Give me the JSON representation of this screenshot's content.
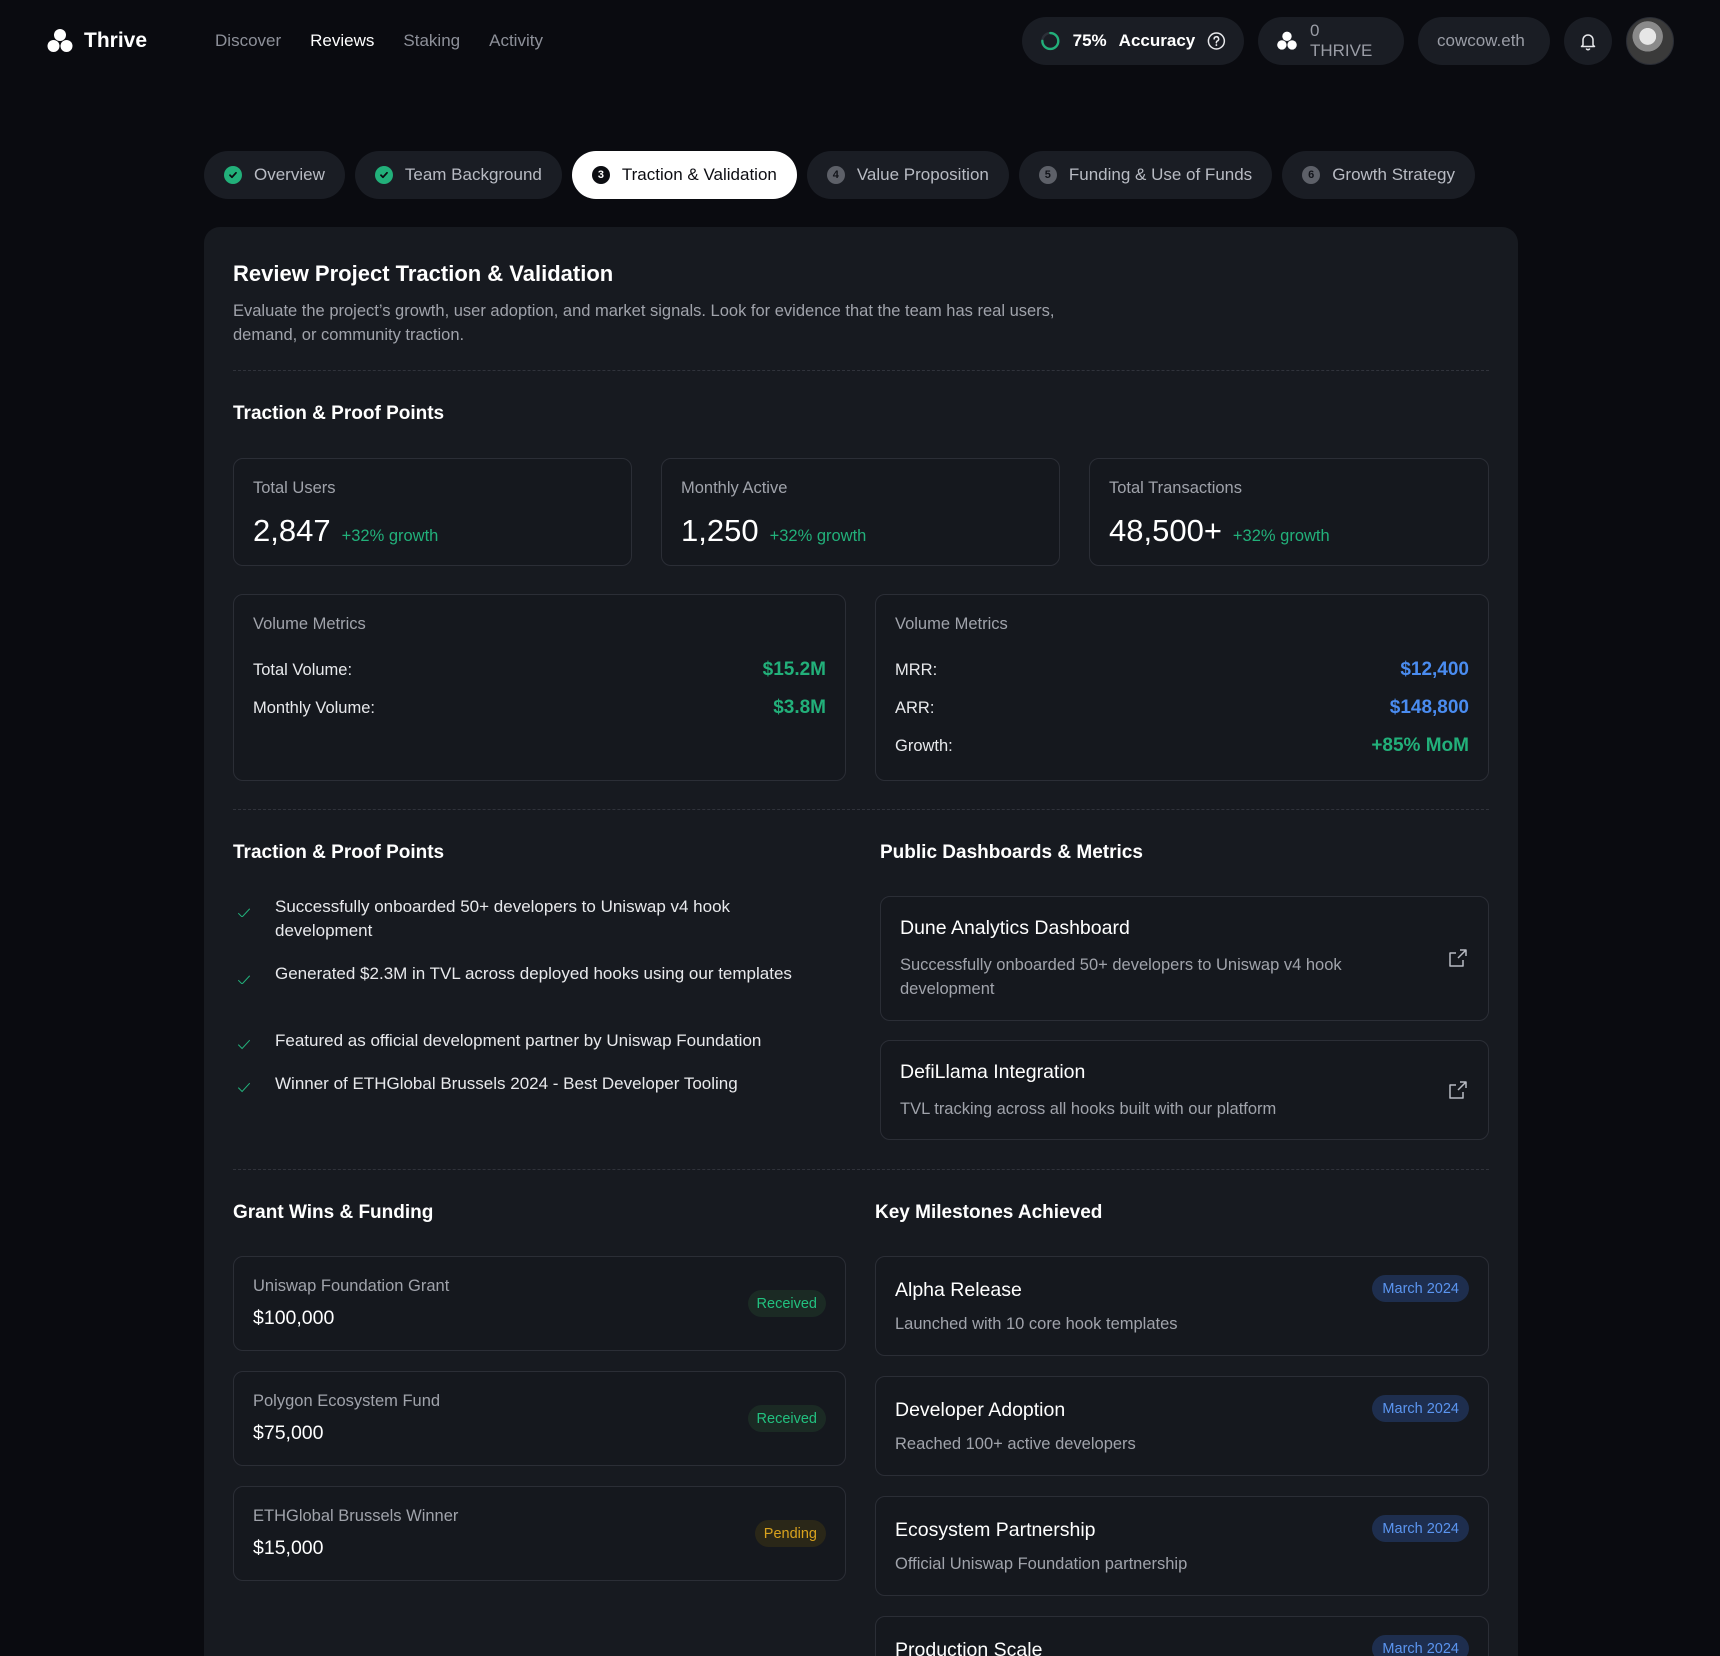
{
  "nav": {
    "brand": "Thrive",
    "links": [
      "Discover",
      "Reviews",
      "Staking",
      "Activity"
    ],
    "active_link": "Reviews",
    "accuracy_pct": "75%",
    "accuracy_label": "Accuracy",
    "thrive_balance": "0 THRIVE",
    "wallet": "cowcow.eth"
  },
  "steps": [
    {
      "label": "Overview",
      "status": "done"
    },
    {
      "label": "Team Background",
      "status": "done"
    },
    {
      "label": "Traction & Validation",
      "status": "active",
      "num": "3"
    },
    {
      "label": "Value Proposition",
      "status": "todo",
      "num": "4"
    },
    {
      "label": "Funding & Use of Funds",
      "status": "todo",
      "num": "5"
    },
    {
      "label": "Growth Strategy",
      "status": "todo",
      "num": "6"
    }
  ],
  "card": {
    "title": "Review Project Traction & Validation",
    "description": "Evaluate the project’s growth, user adoption, and market signals. Look for evidence that the team has real users, demand, or community traction."
  },
  "traction_section_title": "Traction & Proof Points",
  "stats": [
    {
      "label": "Total Users",
      "value": "2,847",
      "growth": "+32% growth"
    },
    {
      "label": "Monthly Active",
      "value": "1,250",
      "growth": "+32% growth"
    },
    {
      "label": "Total Transactions",
      "value": "48,500+",
      "growth": "+32% growth"
    }
  ],
  "volume_left": {
    "title": "Volume Metrics",
    "rows": [
      {
        "label": "Total Volume:",
        "value": "$15.2M"
      },
      {
        "label": "Monthly Volume:",
        "value": "$3.8M"
      }
    ]
  },
  "volume_right": {
    "title": "Volume Metrics",
    "rows": [
      {
        "label": "MRR:",
        "value": "$12,400"
      },
      {
        "label": "ARR:",
        "value": "$148,800"
      },
      {
        "label": "Growth:",
        "value": "+85% MoM"
      }
    ]
  },
  "proof_points": {
    "title": "Traction & Proof Points",
    "items": [
      "Successfully onboarded 50+ developers to Uniswap v4 hook development",
      "Generated $2.3M in TVL across deployed hooks using our templates",
      "Featured as official development partner by Uniswap Foundation",
      "Winner of ETHGlobal Brussels 2024 - Best Developer Tooling"
    ]
  },
  "dashboards": {
    "title": "Public Dashboards & Metrics",
    "items": [
      {
        "title": "Dune Analytics Dashboard",
        "desc": "Successfully onboarded 50+ developers to Uniswap v4 hook development"
      },
      {
        "title": "DefiLlama Integration",
        "desc": "TVL tracking across all hooks built with our platform"
      }
    ]
  },
  "grants": {
    "title": "Grant Wins & Funding",
    "items": [
      {
        "name": "Uniswap Foundation Grant",
        "amount": "$100,000",
        "status": "Received"
      },
      {
        "name": "Polygon Ecosystem Fund",
        "amount": "$75,000",
        "status": "Received"
      },
      {
        "name": "ETHGlobal Brussels Winner",
        "amount": "$15,000",
        "status": "Pending"
      }
    ]
  },
  "milestones": {
    "title": "Key Milestones Achieved",
    "items": [
      {
        "title": "Alpha Release",
        "desc": "Launched with 10 core hook templates",
        "date": "March 2024"
      },
      {
        "title": "Developer Adoption",
        "desc": "Reached 100+ active developers",
        "date": "March 2024"
      },
      {
        "title": "Ecosystem Partnership",
        "desc": "Official Uniswap Foundation partnership",
        "date": "March 2024"
      },
      {
        "title": "Production Scale",
        "desc": "",
        "date": "March 2024"
      }
    ]
  },
  "colors": {
    "background": "#0a0b10",
    "card": "#171a20",
    "green": "#22b07a",
    "blue": "#4a8cf0",
    "pending": "#d8a21e"
  }
}
